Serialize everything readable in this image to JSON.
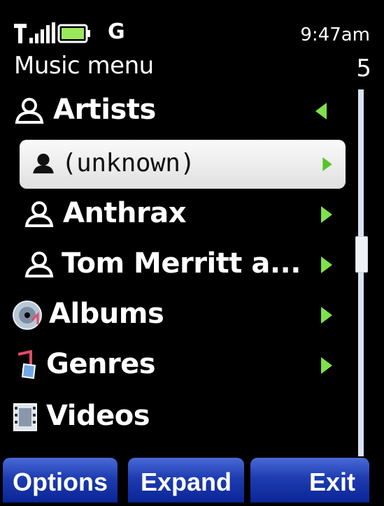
{
  "status": {
    "network": "G",
    "time": "9:47am"
  },
  "header": {
    "title": "Music menu",
    "count": "5"
  },
  "menu": {
    "items": [
      {
        "label": "Artists",
        "icon": "artist-icon",
        "arrow": "left"
      },
      {
        "label": "(unknown)",
        "icon": "artist-icon",
        "arrow": "right",
        "selected": true
      },
      {
        "label": "Anthrax",
        "icon": "artist-icon",
        "arrow": "right"
      },
      {
        "label": "Tom Merritt a...",
        "icon": "artist-icon",
        "arrow": "right"
      },
      {
        "label": "Albums",
        "icon": "album-icon",
        "arrow": "right"
      },
      {
        "label": "Genres",
        "icon": "genre-icon",
        "arrow": "right"
      },
      {
        "label": "Videos",
        "icon": "video-icon",
        "arrow": "none"
      }
    ]
  },
  "softkeys": {
    "left": "Options",
    "middle": "Expand",
    "right": "Exit"
  },
  "colors": {
    "softkey_blue": "#1e3cb0",
    "arrow_green": "#7ee04a",
    "scrollbar": "#d8e3f2"
  }
}
